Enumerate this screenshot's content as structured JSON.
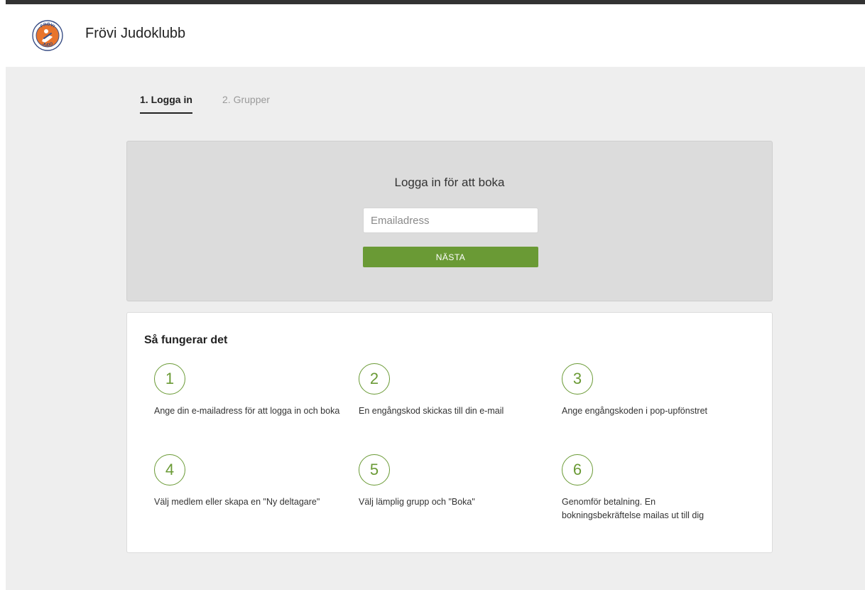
{
  "header": {
    "brand": "Frövi Judoklubb",
    "logo": {
      "top_text": "FRÖVI",
      "bottom_text": "JUDO"
    }
  },
  "steps_nav": [
    {
      "label": "1. Logga in",
      "active": true
    },
    {
      "label": "2. Grupper",
      "active": false
    }
  ],
  "login": {
    "title": "Logga in för att boka",
    "email_placeholder": "Emailadress",
    "email_value": "",
    "next_label": "NÄSTA"
  },
  "how_it_works": {
    "title": "Så fungerar det",
    "steps": [
      {
        "number": "1",
        "text": "Ange din e-mailadress för att logga in och boka"
      },
      {
        "number": "2",
        "text": "En engångskod skickas till din e-mail"
      },
      {
        "number": "3",
        "text": "Ange engångskoden i pop-upfönstret"
      },
      {
        "number": "4",
        "text": "Välj medlem eller skapa en \"Ny deltagare\""
      },
      {
        "number": "5",
        "text": "Välj lämplig grupp och \"Boka\""
      },
      {
        "number": "6",
        "text": "Genomför betalning. En bokningsbekräftelse mailas ut till dig"
      }
    ]
  },
  "colors": {
    "accent_green": "#6a9a35",
    "logo_orange": "#e8742c",
    "logo_ring": "#3a4f86",
    "panel_gray": "#dcdcdc",
    "page_bg": "#eeeeee"
  }
}
